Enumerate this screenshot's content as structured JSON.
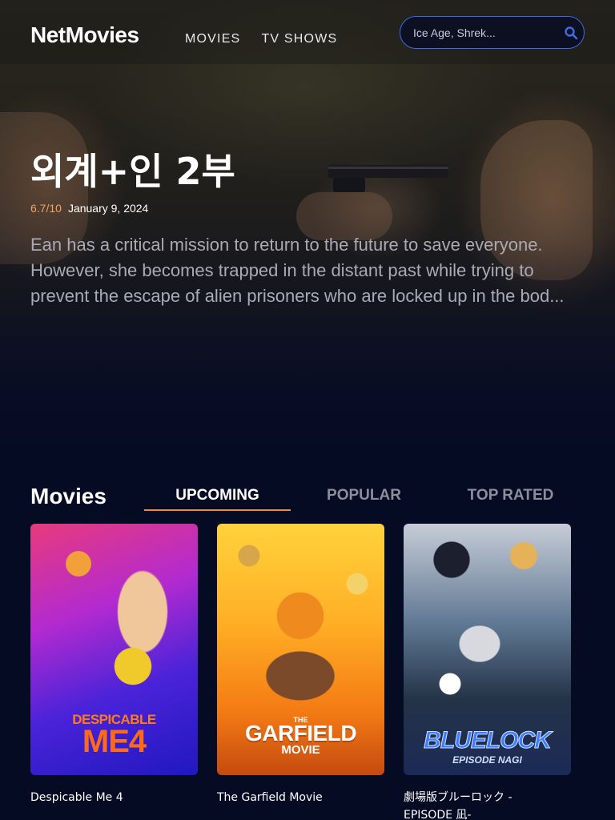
{
  "app": {
    "logo": "NetMovies",
    "nav": [
      "MOVIES",
      "TV SHOWS"
    ],
    "search_placeholder": "Ice Age, Shrek..."
  },
  "hero": {
    "title": "외계+인 2부",
    "rating": "6.7/10",
    "release_date": "January 9, 2024",
    "overview": "Ean has a critical mission to return to the future to save everyone. However, she becomes trapped in the distant past while trying to prevent the escape of alien prisoners who are locked up in the bod..."
  },
  "movies": {
    "title": "Movies",
    "tabs": [
      "UPCOMING",
      "POPULAR",
      "TOP RATED"
    ],
    "active_tab": "UPCOMING",
    "cards": [
      {
        "title": "Despicable Me 4",
        "poster_text": [
          "DESPICABLE",
          "ME4"
        ]
      },
      {
        "title": "The Garfield Movie",
        "poster_text": [
          "THE",
          "GARFIELD",
          "MOVIE"
        ]
      },
      {
        "title": "劇場版ブルーロック -EPISODE 凪-",
        "poster_text": [
          "BLUELOCK",
          "EPISODE NAGI"
        ]
      }
    ]
  },
  "colors": {
    "background": "#060b24",
    "accent": "#e8894a",
    "rating": "#f0a35e",
    "search_border": "#3d6be0"
  }
}
